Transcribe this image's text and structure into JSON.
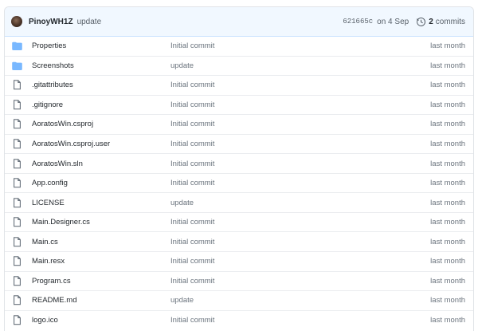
{
  "latest_commit": {
    "author": "PinoyWH1Z",
    "message": "update",
    "sha": "621665c",
    "date": "on 4 Sep",
    "history_count": "2",
    "history_label": "commits"
  },
  "files": [
    {
      "name": "Properties",
      "type": "folder",
      "icon": "folder-icon",
      "commit": "Initial commit",
      "age": "last month"
    },
    {
      "name": "Screenshots",
      "type": "folder",
      "icon": "folder-icon",
      "commit": "update",
      "age": "last month"
    },
    {
      "name": ".gitattributes",
      "type": "file",
      "icon": "file-icon",
      "commit": "Initial commit",
      "age": "last month"
    },
    {
      "name": ".gitignore",
      "type": "file",
      "icon": "file-icon",
      "commit": "Initial commit",
      "age": "last month"
    },
    {
      "name": "AoratosWin.csproj",
      "type": "file",
      "icon": "file-icon",
      "commit": "Initial commit",
      "age": "last month"
    },
    {
      "name": "AoratosWin.csproj.user",
      "type": "file",
      "icon": "file-icon",
      "commit": "Initial commit",
      "age": "last month"
    },
    {
      "name": "AoratosWin.sln",
      "type": "file",
      "icon": "file-icon",
      "commit": "Initial commit",
      "age": "last month"
    },
    {
      "name": "App.config",
      "type": "file",
      "icon": "file-icon",
      "commit": "Initial commit",
      "age": "last month"
    },
    {
      "name": "LICENSE",
      "type": "file",
      "icon": "file-icon",
      "commit": "update",
      "age": "last month"
    },
    {
      "name": "Main.Designer.cs",
      "type": "file",
      "icon": "file-icon",
      "commit": "Initial commit",
      "age": "last month"
    },
    {
      "name": "Main.cs",
      "type": "file",
      "icon": "file-icon",
      "commit": "Initial commit",
      "age": "last month"
    },
    {
      "name": "Main.resx",
      "type": "file",
      "icon": "file-icon",
      "commit": "Initial commit",
      "age": "last month"
    },
    {
      "name": "Program.cs",
      "type": "file",
      "icon": "file-icon",
      "commit": "Initial commit",
      "age": "last month"
    },
    {
      "name": "README.md",
      "type": "file",
      "icon": "file-icon",
      "commit": "update",
      "age": "last month"
    },
    {
      "name": "logo.ico",
      "type": "file",
      "icon": "file-icon",
      "commit": "Initial commit",
      "age": "last month"
    }
  ],
  "colors": {
    "folder": "#79b8ff",
    "header_bg": "#f1f8ff",
    "border": "#e1e4e8",
    "text_primary": "#24292e",
    "text_muted": "#6a737d"
  }
}
